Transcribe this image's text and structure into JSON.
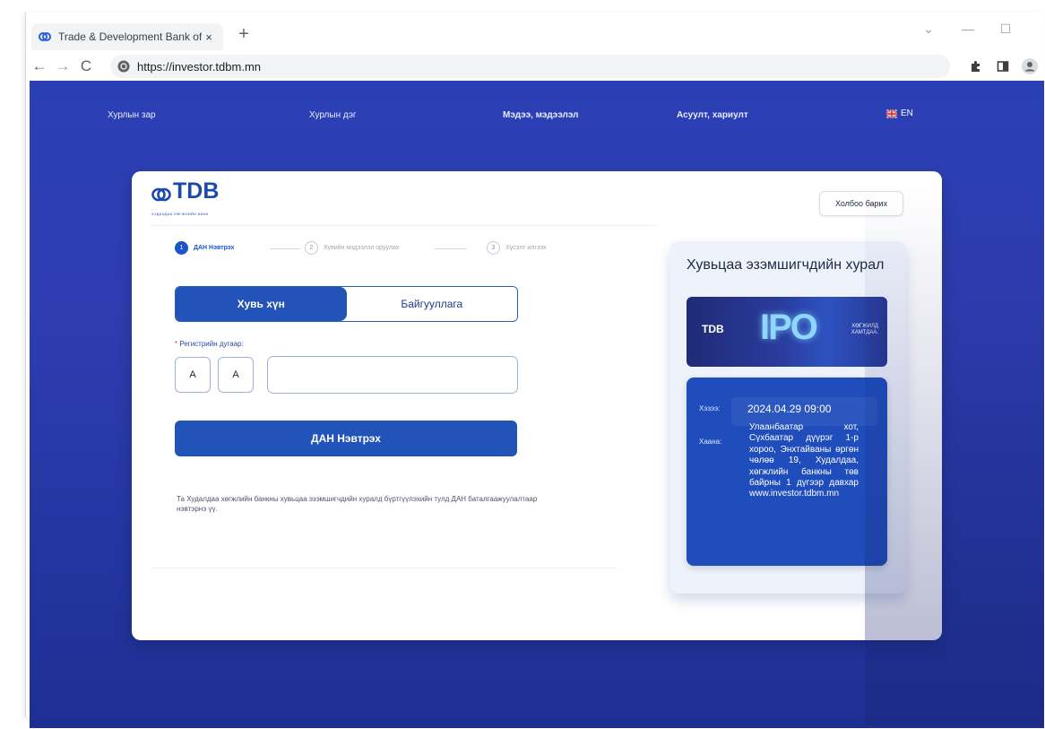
{
  "browser": {
    "tab_title": "Trade & Development Bank of M",
    "tab_close": "×",
    "new_tab": "+",
    "url": "https://investor.tdbm.mn"
  },
  "nav": {
    "items": [
      {
        "label": "Хурлын зар"
      },
      {
        "label": "Хурлын дэг"
      },
      {
        "label": "Мэдээ, мэдээлэл"
      },
      {
        "label": "Асуулт, хариулт"
      }
    ],
    "lang": "EN"
  },
  "header": {
    "logo_word": "TDB",
    "logo_tagline": "ХУДАЛДАА ХӨГЖЛИЙН БАНК",
    "contact_button": "Холбоо барих"
  },
  "steps": [
    {
      "num": "1",
      "label": "ДАН Нэвтрэх"
    },
    {
      "num": "2",
      "label": "Хувийн мэдээлэл оруулах"
    },
    {
      "num": "3",
      "label": "Хүсэлт илгээх"
    }
  ],
  "form": {
    "type_options": [
      "Хувь хүн",
      "Байгууллага"
    ],
    "reg_label": "Регистрийн дугаар:",
    "reg_required_mark": "*",
    "letter1": "А",
    "letter2": "А",
    "reg_value": "",
    "login_button": "ДАН Нэвтрэх",
    "help_text": "Та Худалдаа хөгжлийн банкны хувьцаа эзэмшигчдийн хуралд бүртгүүлэхийн тулд ДАН баталгаажуулалтаар нэвтэрнэ үү."
  },
  "panel": {
    "title": "Хувьцаа эзэмшигчдийн хурал",
    "banner_logo": "TDB",
    "banner_ipo": "IPO",
    "banner_slogan": "ХӨГЖИЛД ХАМТДАА.",
    "when_label": "Хэзээ:",
    "where_label": "Хаана:",
    "date": "2024.04.29 09:00",
    "address": "Улаанбаатар хот, Сүхбаатар дүүрэг 1-р хороо, Энхтайваны өргөн чөлөө 19, Худалдаа, хөгжлийн банкны төв байрны 1 дүгээр давхар www.investor.tdbm.mn"
  },
  "colors": {
    "brand_blue": "#2153b8",
    "background_gradient_top": "#2b3fb4",
    "background_gradient_bottom": "#1e2f93"
  }
}
